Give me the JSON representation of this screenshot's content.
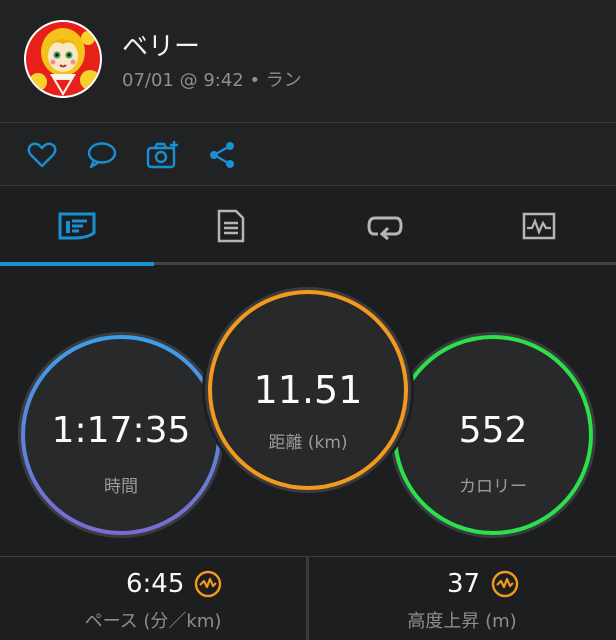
{
  "header": {
    "user_name": "ベリー",
    "meta": "07/01 @ 9:42 • ラン"
  },
  "actions": {
    "icons": [
      "heart-icon",
      "comment-icon",
      "add-photo-icon",
      "share-icon"
    ],
    "accent": "#1a8fd1"
  },
  "tabs": {
    "icons": [
      "stats-icon",
      "details-icon",
      "laps-icon",
      "graph-icon"
    ],
    "active_index": 0
  },
  "stats": {
    "time": {
      "value": "1:17:35",
      "label": "時間"
    },
    "distance": {
      "value": "11.51",
      "label": "距離 (km)"
    },
    "calories": {
      "value": "552",
      "label": "カロリー"
    }
  },
  "bottom": {
    "pace": {
      "value": "6:45",
      "label": "ペース (分／km)"
    },
    "elevation": {
      "value": "37",
      "label": "高度上昇 (m)"
    }
  },
  "colors": {
    "accent_blue": "#1a8fd1",
    "distance_orange": "#f39a1e",
    "calories_green": "#2be04a",
    "time_blue": "#3d9ee8",
    "time_purple": "#7b6bd0"
  }
}
